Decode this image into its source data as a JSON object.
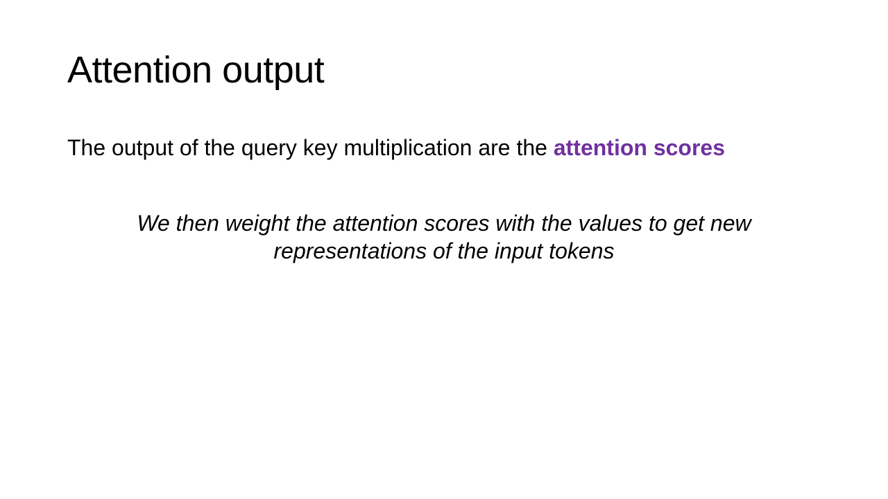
{
  "slide": {
    "title": "Attention output",
    "lead": {
      "text": "The output of the query key multiplication are the ",
      "highlight": "attention scores",
      "highlight_color": "#7030A0"
    },
    "note": "We then weight the attention scores with the values to get new representations of the input tokens"
  }
}
